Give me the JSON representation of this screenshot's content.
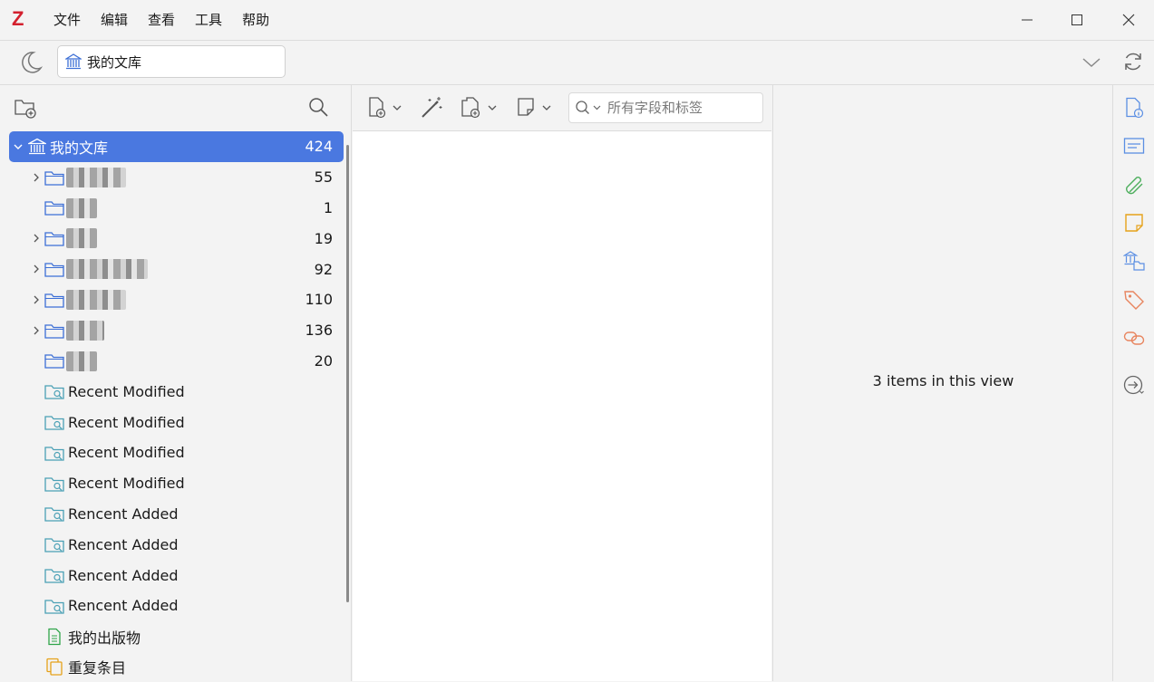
{
  "app": {
    "logo": "Z",
    "menu": [
      "文件",
      "编辑",
      "查看",
      "工具",
      "帮助"
    ]
  },
  "tabbar": {
    "library_tab": "我的文库"
  },
  "collections": [
    {
      "label": "我的文库",
      "count": "424",
      "type": "library",
      "selected": true,
      "expandable": true
    },
    {
      "label": "",
      "count": "55",
      "type": "folder",
      "expandable": true,
      "blurred": true
    },
    {
      "label": "",
      "count": "1",
      "type": "folder",
      "expandable": false,
      "blurred": true
    },
    {
      "label": "",
      "count": "19",
      "type": "folder",
      "expandable": true,
      "blurred": true
    },
    {
      "label": "",
      "count": "92",
      "type": "folder",
      "expandable": true,
      "blurred": true
    },
    {
      "label": "",
      "count": "110",
      "type": "folder",
      "expandable": true,
      "blurred": true
    },
    {
      "label": "",
      "count": "136",
      "type": "folder",
      "expandable": true,
      "blurred": true
    },
    {
      "label": "",
      "count": "20",
      "type": "folder",
      "expandable": false,
      "blurred": true
    },
    {
      "label": "Recent Modified",
      "count": "",
      "type": "saved-search"
    },
    {
      "label": "Recent Modified",
      "count": "",
      "type": "saved-search"
    },
    {
      "label": "Recent Modified",
      "count": "",
      "type": "saved-search"
    },
    {
      "label": "Recent Modified",
      "count": "",
      "type": "saved-search"
    },
    {
      "label": "Rencent Added",
      "count": "",
      "type": "saved-search"
    },
    {
      "label": "Rencent Added",
      "count": "",
      "type": "saved-search"
    },
    {
      "label": "Rencent Added",
      "count": "",
      "type": "saved-search"
    },
    {
      "label": "Rencent Added",
      "count": "",
      "type": "saved-search"
    },
    {
      "label": "我的出版物",
      "count": "",
      "type": "publications"
    },
    {
      "label": "重复条目",
      "count": "",
      "type": "duplicates"
    }
  ],
  "search": {
    "placeholder": "所有字段和标签"
  },
  "item_pane": {
    "message": "3 items in this view"
  },
  "colors": {
    "selection": "#4a78e0",
    "accent_red": "#d3202e",
    "folder_blue": "#3c6fd6",
    "saved_search": "#4aa0b5",
    "publications": "#2fa54a",
    "duplicates": "#e6a21a"
  },
  "sidenav_icons": [
    "info-icon",
    "abstract-icon",
    "attachments-icon",
    "notes-icon",
    "libraries-collections-icon",
    "tags-icon",
    "related-icon",
    "locate-icon"
  ]
}
